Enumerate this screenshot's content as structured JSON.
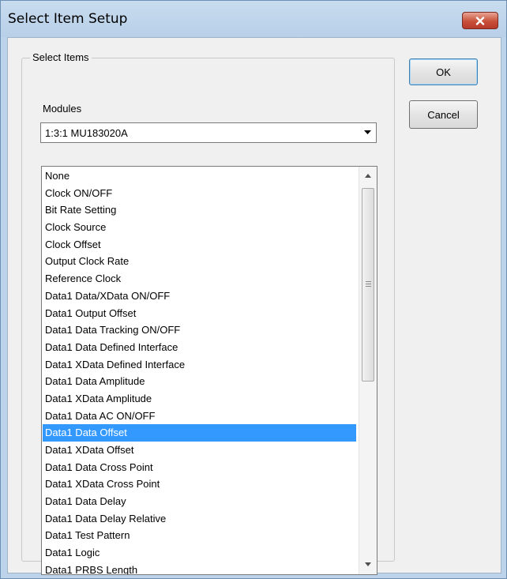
{
  "window": {
    "title": "Select Item Setup"
  },
  "group": {
    "label": "Select Items"
  },
  "modules": {
    "label": "Modules",
    "selected": "1:3:1 MU183020A"
  },
  "items": [
    "None",
    "Clock ON/OFF",
    "Bit Rate Setting",
    "Clock Source",
    "Clock Offset",
    "Output Clock Rate",
    "Reference Clock",
    "Data1 Data/XData ON/OFF",
    "Data1 Output Offset",
    "Data1 Data Tracking ON/OFF",
    "Data1 Data Defined Interface",
    "Data1 XData Defined Interface",
    "Data1 Data Amplitude",
    "Data1 XData Amplitude",
    "Data1 Data AC ON/OFF",
    "Data1 Data Offset",
    "Data1 XData Offset",
    "Data1 Data Cross Point",
    "Data1 XData Cross Point",
    "Data1 Data Delay",
    "Data1 Data Delay Relative",
    "Data1 Test Pattern",
    "Data1 Logic",
    "Data1 PRBS Length"
  ],
  "selected_item": "Data1 Data Offset",
  "buttons": {
    "ok": "OK",
    "cancel": "Cancel"
  },
  "colors": {
    "selection": "#3399ff",
    "close_button": "#c8503a",
    "titlebar": "#bcd3ea"
  },
  "icons": {
    "close": "close-icon",
    "dropdown": "chevron-down-icon",
    "scroll_up": "arrow-up-icon",
    "scroll_down": "arrow-down-icon"
  }
}
